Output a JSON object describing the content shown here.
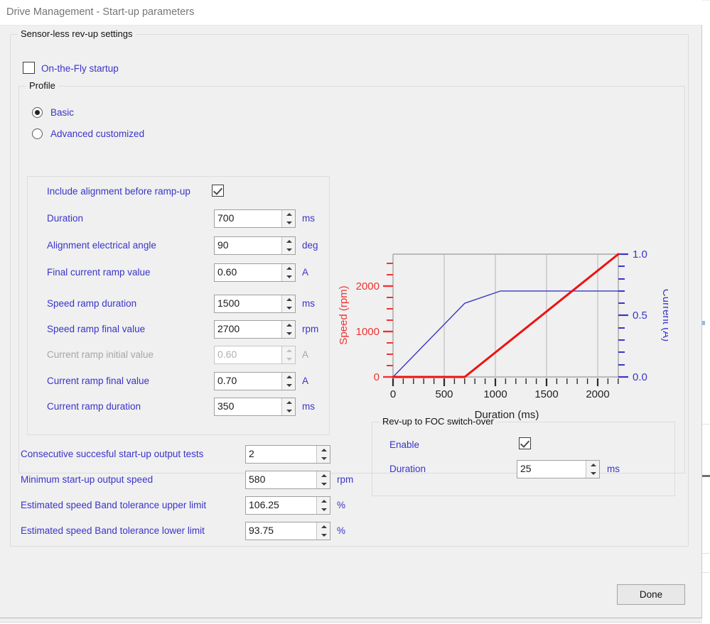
{
  "window": {
    "title": "Drive Management - Start-up parameters"
  },
  "sensorless_group": {
    "legend": "Sensor-less rev-up settings",
    "on_the_fly": {
      "label": "On-the-Fly startup",
      "checked": false
    }
  },
  "profile_group": {
    "legend": "Profile",
    "options": [
      {
        "label": "Basic",
        "selected": true
      },
      {
        "label": "Advanced customized",
        "selected": false
      }
    ]
  },
  "ramp_panel": {
    "include_alignment": {
      "label": "Include alignment before ramp-up",
      "checked": true
    },
    "fields": [
      {
        "label": "Duration",
        "value": "700",
        "unit": "ms",
        "disabled": false
      },
      {
        "label": "Alignment electrical angle",
        "value": "90",
        "unit": "deg",
        "disabled": false
      },
      {
        "label": "Final current ramp value",
        "value": "0.60",
        "unit": "A",
        "disabled": false
      },
      {
        "label": "Speed ramp duration",
        "value": "1500",
        "unit": "ms",
        "disabled": false
      },
      {
        "label": "Speed ramp final value",
        "value": "2700",
        "unit": "rpm",
        "disabled": false
      },
      {
        "label": "Current ramp initial value",
        "value": "0.60",
        "unit": "A",
        "disabled": true
      },
      {
        "label": "Current ramp final value",
        "value": "0.70",
        "unit": "A",
        "disabled": false
      },
      {
        "label": "Current ramp duration",
        "value": "350",
        "unit": "ms",
        "disabled": false
      }
    ]
  },
  "bottom_fields": [
    {
      "label": "Consecutive succesful start-up output tests",
      "value": "2",
      "unit": ""
    },
    {
      "label": "Minimum start-up output speed",
      "value": "580",
      "unit": "rpm"
    },
    {
      "label": "Estimated speed Band tolerance upper limit",
      "value": "106.25",
      "unit": "%"
    },
    {
      "label": "Estimated speed Band tolerance lower limit",
      "value": "93.75",
      "unit": "%"
    }
  ],
  "foc_group": {
    "legend": "Rev-up to FOC switch-over",
    "enable": {
      "label": "Enable",
      "checked": true
    },
    "duration": {
      "label": "Duration",
      "value": "25",
      "unit": "ms"
    }
  },
  "footer": {
    "done_label": "Done"
  },
  "colors": {
    "speed": "#ee1111",
    "current": "#3a34c8",
    "label_blue": "#3a34c8",
    "axis": "#808080",
    "grid": "#aaaaaa",
    "panel": "#f0f0f0"
  },
  "chart_data": {
    "type": "line",
    "title": "",
    "xlabel": "Duration (ms)",
    "ylabel": "Speed (rpm)",
    "y2label": "Current (A)",
    "xlim": [
      0,
      2200
    ],
    "ylim": [
      0,
      2700
    ],
    "y2lim": [
      0,
      1.0
    ],
    "xticks": [
      0,
      500,
      1000,
      1500,
      2000
    ],
    "xticklabels": [
      "0",
      "500",
      "1000",
      "1500",
      "2000"
    ],
    "xminor_step": 100,
    "yticks": [
      0,
      1000,
      2000
    ],
    "yticklabels": [
      "0",
      "1000",
      "2000"
    ],
    "yminor_step": 250,
    "y2ticks": [
      0.0,
      0.5,
      1.0
    ],
    "y2ticklabels": [
      "0.0",
      "0.5",
      "1.0"
    ],
    "y2minor_step": 0.1,
    "grid": true,
    "legend": "none",
    "series": [
      {
        "name": "Speed (rpm)",
        "axis": "left",
        "color": "#ee1111",
        "width": 3,
        "points": [
          [
            0,
            0
          ],
          [
            700,
            0
          ],
          [
            2200,
            2700
          ]
        ]
      },
      {
        "name": "Current (A)",
        "axis": "right",
        "color": "#3a34c8",
        "width": 1.4,
        "points": [
          [
            0,
            0.0
          ],
          [
            700,
            0.6
          ],
          [
            1050,
            0.7
          ],
          [
            2200,
            0.7
          ]
        ]
      }
    ]
  }
}
